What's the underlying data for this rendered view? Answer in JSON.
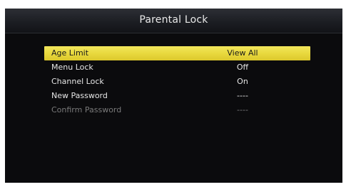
{
  "header": {
    "title": "Parental Lock"
  },
  "menu": {
    "items": [
      {
        "label": "Age Limit",
        "value": "View All",
        "state": "selected"
      },
      {
        "label": "Menu Lock",
        "value": "Off",
        "state": "normal"
      },
      {
        "label": "Channel Lock",
        "value": "On",
        "state": "normal"
      },
      {
        "label": "New Password",
        "value": "----",
        "state": "normal"
      },
      {
        "label": "Confirm Password",
        "value": "----",
        "state": "disabled"
      }
    ]
  },
  "colors": {
    "highlight": "#e9d93e",
    "background": "#0b0b0d",
    "text": "#e6e6e6",
    "disabled_text": "#7a7a7a"
  }
}
